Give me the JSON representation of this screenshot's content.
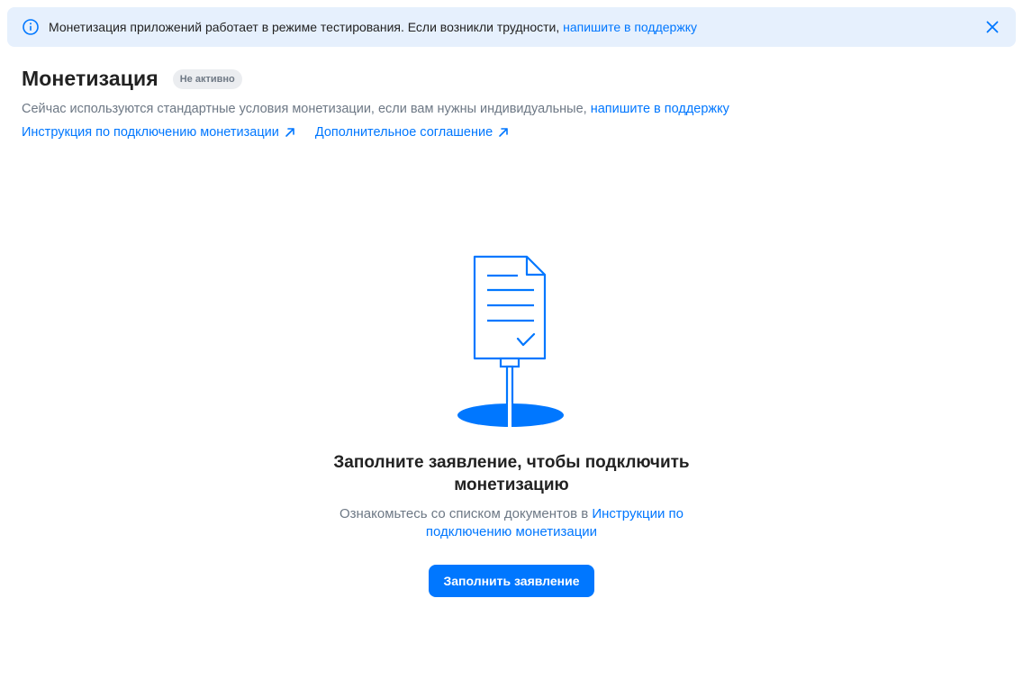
{
  "banner": {
    "text": "Монетизация приложений работает в режиме тестирования. Если возникли трудности,",
    "link": "напишите в поддержку",
    "icon": "info-icon",
    "close_icon": "close-icon"
  },
  "header": {
    "title": "Монетизация",
    "status": "Не активно",
    "subtitle": "Сейчас используются стандартные условия монетизации, если вам нужны индивидуальные,",
    "subtitle_link": "напишите в поддержку",
    "links": [
      {
        "label": "Инструкция по подключению монетизации",
        "icon": "external-arrow-icon"
      },
      {
        "label": "Дополнительное соглашение",
        "icon": "external-arrow-icon"
      }
    ]
  },
  "empty_state": {
    "illustration": "document-stand-illustration",
    "title": "Заполните заявление, чтобы подключить монетизацию",
    "desc_text": "Ознакомьтесь со списком документов в",
    "desc_link": "Инструкции по подключению монетизации",
    "button_label": "Заполнить заявление"
  },
  "colors": {
    "accent": "#0077ff",
    "banner_bg": "#e6f0fd",
    "badge_bg": "#ebedf0",
    "secondary_text": "#6d7885",
    "primary_text": "#222222"
  }
}
